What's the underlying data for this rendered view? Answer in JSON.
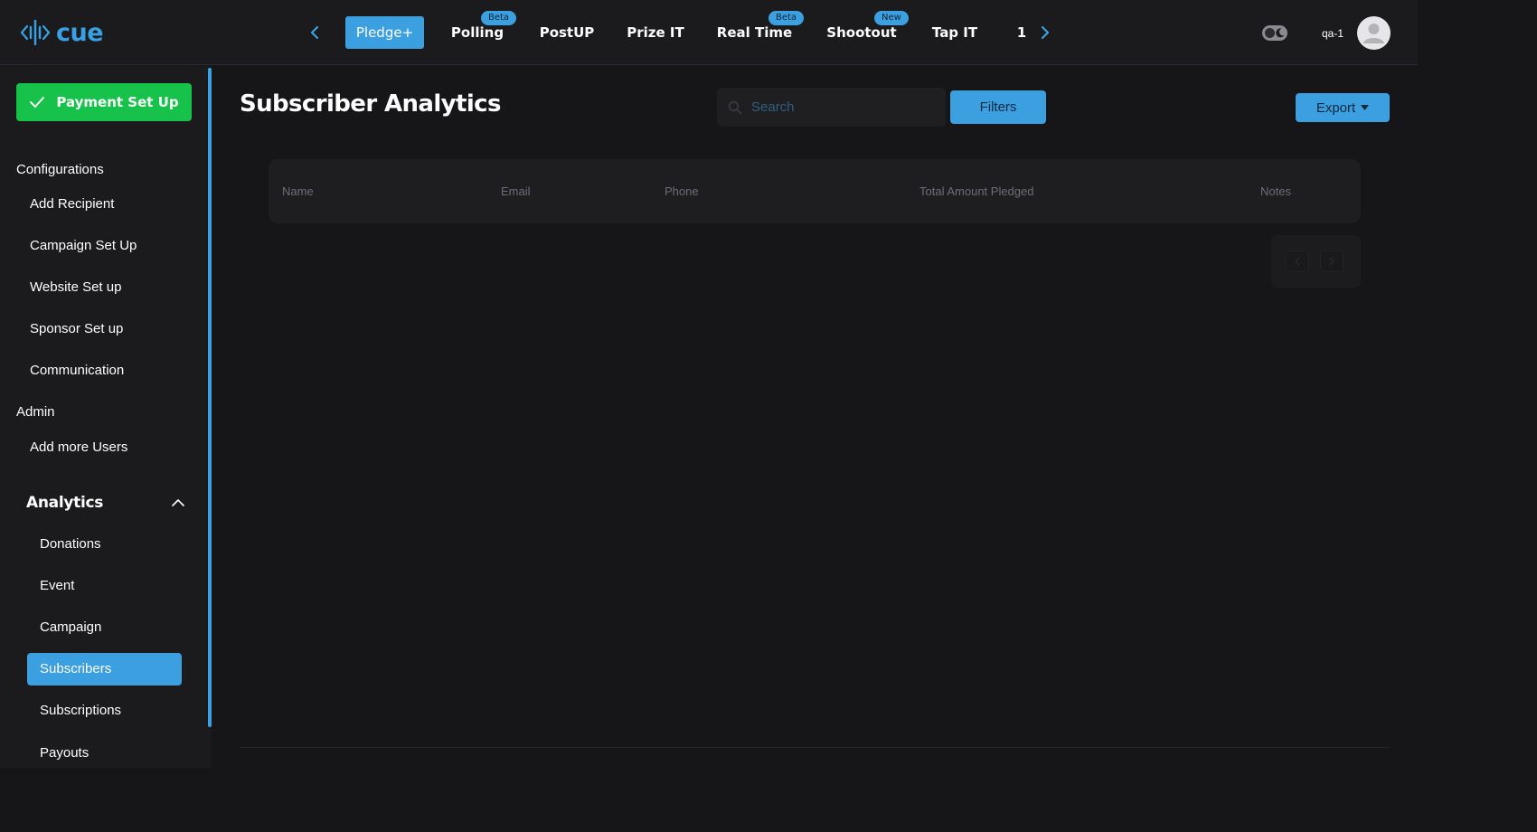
{
  "brand": {
    "logo_text": "cue",
    "accent": "#3b9fe0"
  },
  "topnav": {
    "prev_icon": "chevron-left-icon",
    "next_icon": "chevron-right-icon",
    "tabs": [
      {
        "label": "Pledge+",
        "active": true,
        "badge": ""
      },
      {
        "label": "Polling",
        "active": false,
        "badge": "Beta"
      },
      {
        "label": "PostUP",
        "active": false,
        "badge": ""
      },
      {
        "label": "Prize IT",
        "active": false,
        "badge": ""
      },
      {
        "label": "Real Time",
        "active": false,
        "badge": "Beta"
      },
      {
        "label": "Shootout",
        "active": false,
        "badge": "New"
      },
      {
        "label": "Tap IT",
        "active": false,
        "badge": ""
      },
      {
        "label": "1",
        "active": false,
        "badge": ""
      }
    ],
    "username": "qa-1"
  },
  "sidebar": {
    "payment_button": "Payment Set Up",
    "sections": [
      {
        "title": "Configurations",
        "items": [
          "Add Recipient",
          "Campaign Set Up",
          "Website Set up",
          "Sponsor Set up",
          "Communication"
        ]
      },
      {
        "title": "Admin",
        "items": [
          "Add more Users"
        ]
      }
    ],
    "analytics": {
      "title": "Analytics",
      "expanded": true,
      "items": [
        "Donations",
        "Event",
        "Campaign",
        "Subscribers",
        "Subscriptions",
        "Payouts"
      ],
      "active": "Subscribers"
    }
  },
  "main": {
    "title": "Subscriber Analytics",
    "search_placeholder": "Search",
    "filters_label": "Filters",
    "export_label": "Export",
    "columns": [
      "Name",
      "Email",
      "Phone",
      "Total Amount Pledged",
      "Notes"
    ]
  }
}
